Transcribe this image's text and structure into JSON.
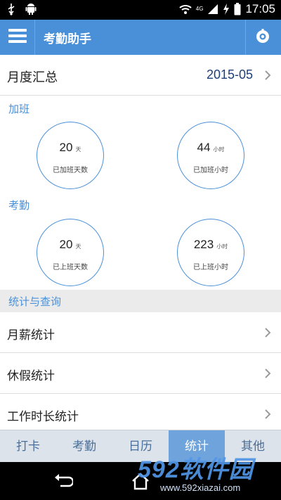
{
  "status_bar": {
    "time": "17:05",
    "network": "4G"
  },
  "app_bar": {
    "title": "考勤助手"
  },
  "summary": {
    "label": "月度汇总",
    "month": "2015-05"
  },
  "overtime": {
    "label": "加班",
    "days": {
      "value": "20",
      "unit": "天",
      "caption": "已加班天数"
    },
    "hours": {
      "value": "44",
      "unit": "小时",
      "caption": "已加班小时"
    }
  },
  "attendance": {
    "label": "考勤",
    "days": {
      "value": "20",
      "unit": "天",
      "caption": "已上班天数"
    },
    "hours": {
      "value": "223",
      "unit": "小时",
      "caption": "已上班小时"
    }
  },
  "query": {
    "header": "统计与查询",
    "items": [
      {
        "label": "月薪统计"
      },
      {
        "label": "休假统计"
      },
      {
        "label": "工作时长统计"
      }
    ]
  },
  "tabs": [
    {
      "label": "打卡"
    },
    {
      "label": "考勤"
    },
    {
      "label": "日历"
    },
    {
      "label": "统计",
      "active": true
    },
    {
      "label": "其他"
    }
  ],
  "watermark": {
    "brand": "592软件园",
    "url": "www.592xiazai.com"
  },
  "colors": {
    "accent": "#4a90d9",
    "month_text": "#1f3f7a",
    "tab_active": "#6fa3dc"
  }
}
